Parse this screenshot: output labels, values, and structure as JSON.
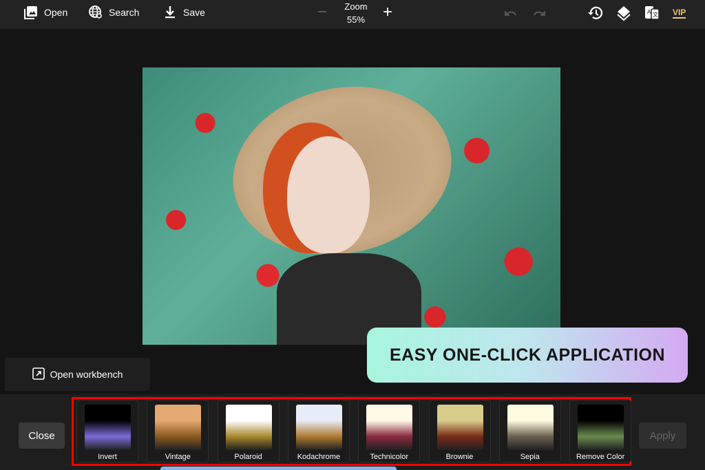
{
  "toolbar": {
    "open": "Open",
    "search": "Search",
    "save": "Save",
    "zoom_label": "Zoom",
    "zoom_value": "55%",
    "vip": "VIP"
  },
  "workbench": {
    "label": "Open workbench"
  },
  "banner": {
    "text": "EASY ONE-CLICK APPLICATION"
  },
  "actions": {
    "close": "Close",
    "apply": "Apply"
  },
  "filters": [
    {
      "label": "Invert",
      "top": "#000000",
      "bottom": "#7a6ad8"
    },
    {
      "label": "Vintage",
      "top": "#e4a872",
      "bottom": "#8a5a20"
    },
    {
      "label": "Polaroid",
      "top": "#ffffff",
      "bottom": "#a8882a"
    },
    {
      "label": "Kodachrome",
      "top": "#e8ecf8",
      "bottom": "#b07a30"
    },
    {
      "label": "Technicolor",
      "top": "#fffae8",
      "bottom": "#8a2a40"
    },
    {
      "label": "Brownie",
      "top": "#d8cc8a",
      "bottom": "#7a2a18"
    },
    {
      "label": "Sepia",
      "top": "#fffbe0",
      "bottom": "#6a6050"
    },
    {
      "label": "Remove Color",
      "top": "#000000",
      "bottom": "#6a8a50"
    }
  ],
  "colors": {
    "highlight": "#ff0000",
    "vip": "#f0c27a"
  }
}
